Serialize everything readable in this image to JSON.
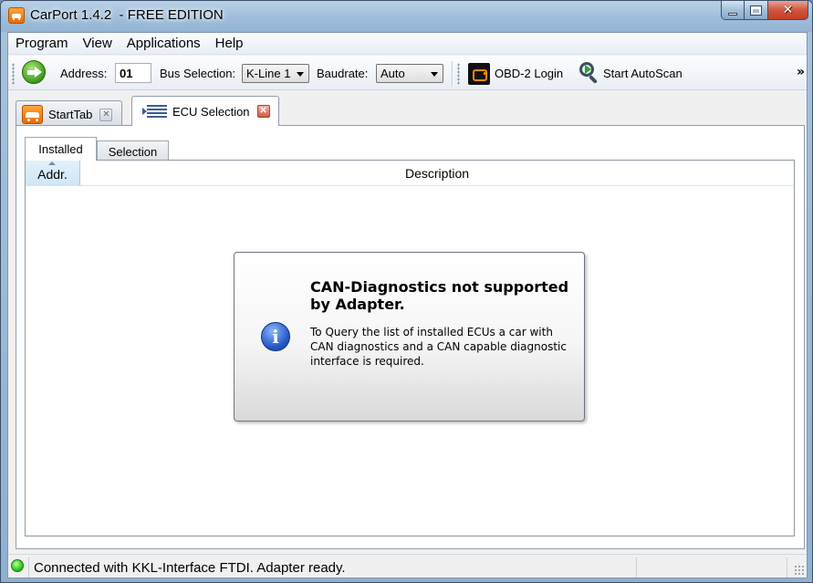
{
  "window": {
    "title": "CarPort 1.4.2  - FREE EDITION",
    "minimize_label": "",
    "close_label": "✕"
  },
  "menu": {
    "items": [
      "Program",
      "View",
      "Applications",
      "Help"
    ]
  },
  "toolbar": {
    "address_label": "Address:",
    "address_value": "01",
    "bus_label": "Bus Selection:",
    "bus_value": "K-Line 1",
    "baud_label": "Baudrate:",
    "baud_value": "Auto",
    "obd_login_label": "OBD-2 Login",
    "autoscan_label": "Start AutoScan",
    "overflow_label": "»"
  },
  "tabs": [
    {
      "label": "StartTab",
      "icon": "car-icon",
      "active": false
    },
    {
      "label": "ECU Selection",
      "icon": "list-icon",
      "active": true
    }
  ],
  "subtabs": [
    {
      "label": "Installed",
      "active": true
    },
    {
      "label": "Selection",
      "active": false
    }
  ],
  "list": {
    "columns": [
      "Addr.",
      "Description"
    ]
  },
  "dialog": {
    "title": "CAN-Diagnostics not supported by Adapter.",
    "message": "To Query the list of installed ECUs a car with CAN diagnostics and a CAN capable diagnostic interface is required.",
    "icon": "info-icon",
    "icon_glyph": "i"
  },
  "status": {
    "text": "Connected with KKL-Interface FTDI. Adapter ready.",
    "indicator_color": "#2fc91d"
  },
  "colors": {
    "accent_orange": "#e86c00",
    "close_red": "#c33e24"
  }
}
